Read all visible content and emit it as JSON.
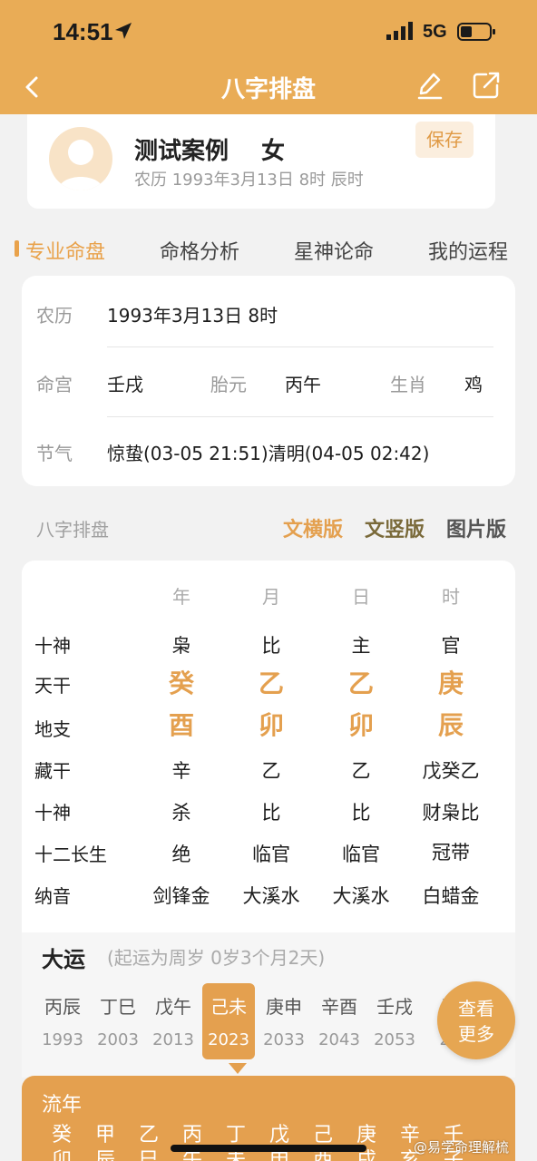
{
  "status": {
    "time": "14:51",
    "network": "5G"
  },
  "nav": {
    "title": "八字排盘"
  },
  "profile": {
    "name": "测试案例",
    "gender": "女",
    "lunar": "农历 1993年3月13日 8时 辰时",
    "save": "保存"
  },
  "tabs": [
    {
      "label": "专业命盘",
      "active": true
    },
    {
      "label": "命格分析"
    },
    {
      "label": "星神论命"
    },
    {
      "label": "我的运程"
    }
  ],
  "info": {
    "lunar_label": "农历",
    "lunar_value": "1993年3月13日 8时",
    "minggong_label": "命宫",
    "minggong_value": "壬戌",
    "taiyuan_label": "胎元",
    "taiyuan_value": "丙午",
    "shengxiao_label": "生肖",
    "shengxiao_value": "鸡",
    "jieqi_label": "节气",
    "jieqi_value": "惊蛰(03-05 21:51)清明(04-05 02:42)"
  },
  "section": {
    "title": "八字排盘",
    "versions": [
      "文横版",
      "文竖版",
      "图片版"
    ],
    "colors": [
      "#e4a04f",
      "#7a6a3a",
      "#555555"
    ]
  },
  "pillars": {
    "headers": [
      "年",
      "月",
      "日",
      "时"
    ],
    "rows": [
      {
        "label": "十神",
        "values": [
          "枭",
          "比",
          "主",
          "官"
        ]
      },
      {
        "label": "天干",
        "values": [
          "癸",
          "乙",
          "乙",
          "庚"
        ],
        "big": true
      },
      {
        "label": "地支",
        "values": [
          "酉",
          "卯",
          "卯",
          "辰"
        ],
        "big": true
      },
      {
        "label": "藏干",
        "values": [
          "辛",
          "乙",
          "乙",
          "戊癸乙"
        ]
      },
      {
        "label": "十神",
        "values": [
          "杀",
          "比",
          "比",
          "财枭比"
        ]
      },
      {
        "label": "十二长生",
        "values": [
          "绝",
          "临官",
          "临官",
          "冠带"
        ]
      },
      {
        "label": "纳音",
        "values": [
          "剑锋金",
          "大溪水",
          "大溪水",
          "白蜡金"
        ]
      }
    ]
  },
  "dayun": {
    "title": "大运",
    "subtitle": "(起运为周岁 0岁3个月2天)",
    "items": [
      {
        "gz": "丙辰",
        "year": "1993"
      },
      {
        "gz": "丁巳",
        "year": "2003"
      },
      {
        "gz": "戊午",
        "year": "2013"
      },
      {
        "gz": "己未",
        "year": "2023",
        "active": true
      },
      {
        "gz": "庚申",
        "year": "2033"
      },
      {
        "gz": "辛酉",
        "year": "2043"
      },
      {
        "gz": "壬戌",
        "year": "2053"
      },
      {
        "gz": "癸",
        "year": "20"
      }
    ],
    "more": "查看更多"
  },
  "liunian": {
    "title": "流年",
    "items": [
      {
        "gan": "癸",
        "zhi": "卯"
      },
      {
        "gan": "甲",
        "zhi": "辰"
      },
      {
        "gan": "乙",
        "zhi": "巳"
      },
      {
        "gan": "丙",
        "zhi": "午"
      },
      {
        "gan": "丁",
        "zhi": "未"
      },
      {
        "gan": "戊",
        "zhi": "申"
      },
      {
        "gan": "己",
        "zhi": "酉"
      },
      {
        "gan": "庚",
        "zhi": "戌"
      },
      {
        "gan": "辛",
        "zhi": "亥"
      },
      {
        "gan": "壬",
        "zhi": "子"
      }
    ]
  },
  "watermark": "@易学命理解梳"
}
